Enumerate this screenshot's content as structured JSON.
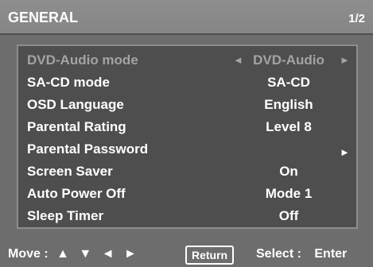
{
  "header": {
    "title": "GENERAL",
    "page": "1/2"
  },
  "menu": {
    "items": [
      {
        "label": "DVD-Audio mode",
        "value": "DVD-Audio",
        "left_arrow": "◄",
        "right_arrow": "►",
        "state": "disabled"
      },
      {
        "label": "SA-CD mode",
        "value": "SA-CD"
      },
      {
        "label": "OSD Language",
        "value": "English"
      },
      {
        "label": "Parental Rating",
        "value": "Level 8"
      },
      {
        "label": "Parental Password",
        "right_arrow": "►"
      },
      {
        "label": "Screen Saver",
        "value": "On"
      },
      {
        "label": "Auto Power Off",
        "value": "Mode 1"
      },
      {
        "label": "Sleep Timer",
        "value": "Off"
      }
    ]
  },
  "footer": {
    "move_label": "Move :",
    "move_arrows": "▲ ▼ ◄ ►",
    "return_label": "Return",
    "select_label": "Select :",
    "enter_label": "Enter"
  },
  "colors": {
    "background": "#6d6d6d",
    "panel": "#4e4e4e",
    "text": "#ffffff",
    "disabled_text": "#a3a3a3"
  }
}
